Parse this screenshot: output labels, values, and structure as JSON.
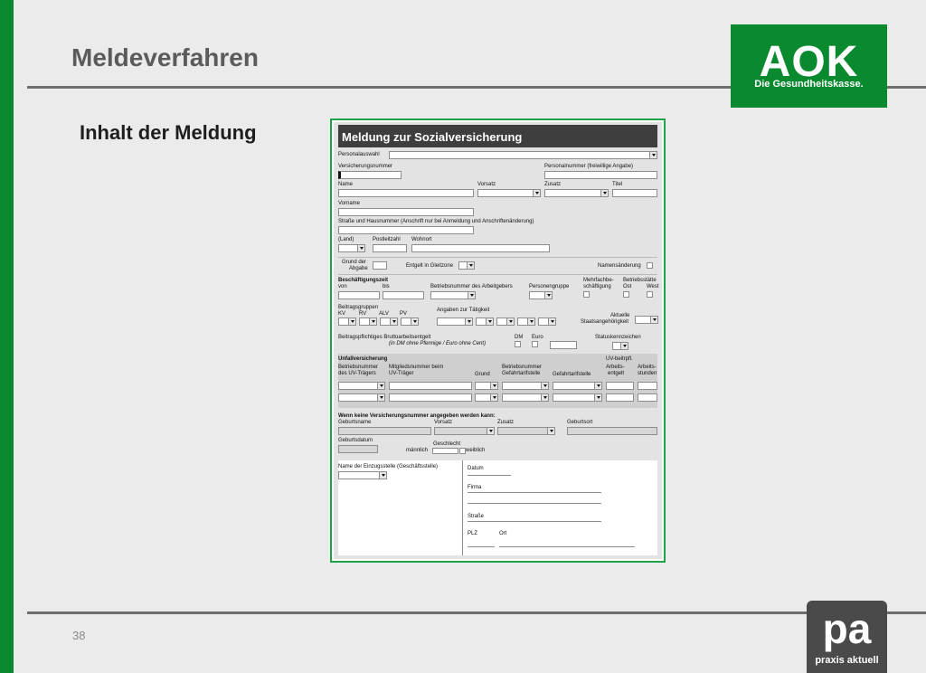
{
  "slide": {
    "title": "Meldeverfahren",
    "subtitle": "Inhalt der Meldung",
    "page_number": "38"
  },
  "logos": {
    "aok": {
      "wordmark": "AOK",
      "tagline": "Die Gesundheitskasse.",
      "color": "#0a8a2f"
    },
    "pa": {
      "wordmark": "pa",
      "tagline": "praxis aktuell",
      "color": "#4a4a4a"
    }
  },
  "form": {
    "title": "Meldung zur Sozialversicherung",
    "personalauswahl": "Personalauswahl",
    "versicherungsnummer": "Versicherungsnummer",
    "personalnummer": "Personalnummer (freiwillige Angabe)",
    "name": "Name",
    "vorsatz": "Vorsatz",
    "zusatz": "Zusatz",
    "titel": "Titel",
    "vorname": "Vorname",
    "strasse_haus": "Straße und Hausnummer (Anschrift nur bei Anmeldung und Anschriftenänderung)",
    "land": "(Land)",
    "postleitzahl": "Postleitzahl",
    "wohnort": "Wohnort",
    "grund_der": "Grund der",
    "abgabe": "Abgabe",
    "entgelt_gleitzone": "Entgelt in Gleitzone",
    "namensaenderung": "Namensänderung",
    "beschaeftigungszeit": "Beschäftigungszeit",
    "von": "von",
    "bis": "bis",
    "betriebsnummer_ag": "Betriebsnummer des Arbeitgebers",
    "personengruppe": "Personengruppe",
    "mehrfach_1": "Mehrfachbe-",
    "mehrfach_2": "schäftigung",
    "betriebsstaette": "Betriebsstätte",
    "ost": "Ost",
    "west": "West",
    "beitragsgruppen": "Beitragsgruppen",
    "kv": "KV",
    "rv": "RV",
    "alv": "ALV",
    "pv": "PV",
    "angaben_taetigkeit": "Angaben zur Tätigkeit",
    "aktuelle": "Aktuelle",
    "staatsangehoerigkeit": "Staatsangehörigkeit",
    "beitragspflichtiges": "Beitragspflichtiges Bruttoarbeitsentgelt",
    "dm_euro_hint": "(in DM ohne Pfennige / Euro ohne Cent)",
    "dm": "DM",
    "euro": "Euro",
    "statuskennzeichen": "Statuskennzeichen",
    "unfallversicherung": "Unfallversicherung",
    "uv_betriebsnummer": "Betriebsnummer",
    "uv_traegers": "des UV-Trägers",
    "mitgliedsnummer": "Mitgliedsnummer beim",
    "uv_traeger": "UV-Träger",
    "grund": "Grund",
    "gefahrtarif_bn": "Betriebsnummer",
    "gefahrtarif_st": "Gefahrtarifstelle",
    "gefahrtarifstelle": "Gefahrtarifstelle",
    "uv_beitr_1": "UV-beitrpfl.",
    "uv_beitr_2": "Arbeits-",
    "uv_beitr_3": "entgelt",
    "arbeitsstunden_1": "Arbeits-",
    "arbeitsstunden_2": "stunden",
    "keine_vsnr": "Wenn keine Versicherungsnummer angegeben werden kann:",
    "geburtsname": "Geburtsname",
    "vorsatz2": "Vorsatz",
    "zusatz2": "Zusatz",
    "geburtsort": "Geburtsort",
    "geburtsdatum": "Geburtsdatum",
    "geschlecht": "Geschlecht",
    "maennlich": "männlich",
    "weiblich": "weiblich",
    "einzugsstelle": "Name der Einzugsstelle (Geschäftsstelle)",
    "datum": "Datum",
    "firma": "Firma",
    "strasse": "Straße",
    "plz": "PLZ",
    "ort": "Ort"
  }
}
